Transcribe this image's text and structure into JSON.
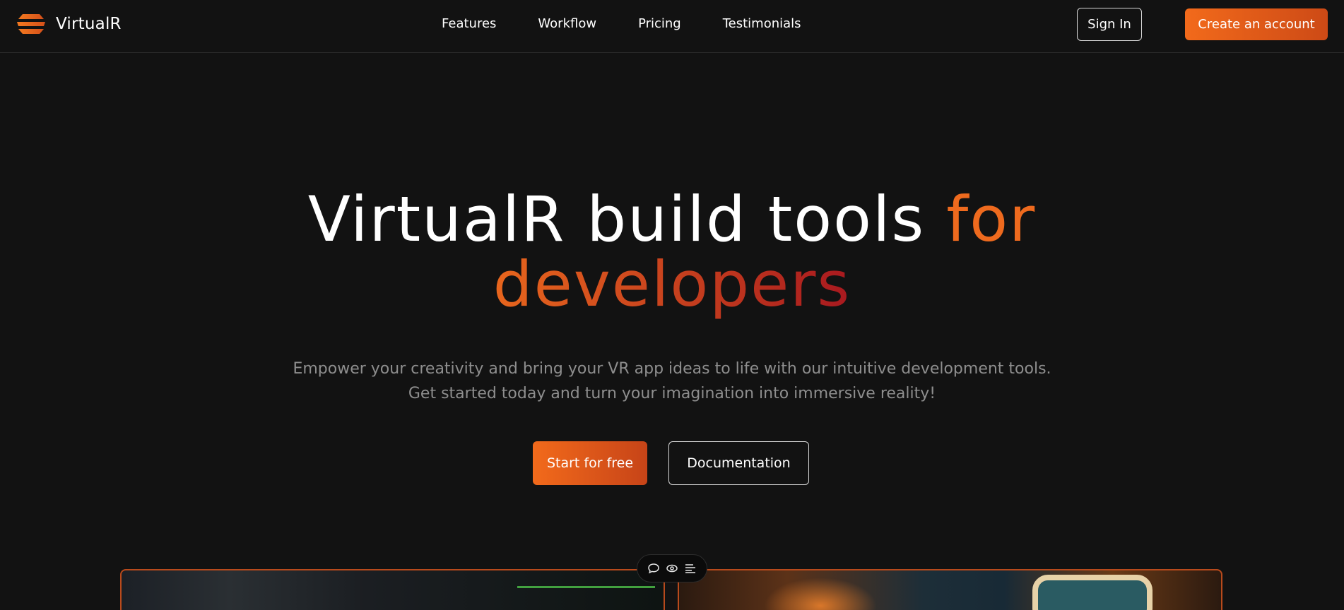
{
  "brand": {
    "name": "VirtualR",
    "logo_icon": "stacked-bars-logo"
  },
  "nav": {
    "links": [
      "Features",
      "Workflow",
      "Pricing",
      "Testimonials"
    ],
    "sign_in": "Sign In",
    "create_account": "Create an account"
  },
  "hero": {
    "title_part1": "VirtualR build tools ",
    "title_part2": "for",
    "title_part3": "developers",
    "subtitle_line1": "Empower your creativity and bring your VR app ideas to life with our intuitive development tools.",
    "subtitle_line2": "Get started today and turn your imagination into immersive reality!",
    "cta_primary": "Start for free",
    "cta_secondary": "Documentation"
  },
  "toolbar": {
    "icons": [
      "comment-icon",
      "eye-icon",
      "list-icon"
    ]
  },
  "colors": {
    "background": "#121212",
    "accent": "#f26a1b",
    "accent_dark": "#a8191f",
    "muted_text": "#8e8e8e"
  }
}
